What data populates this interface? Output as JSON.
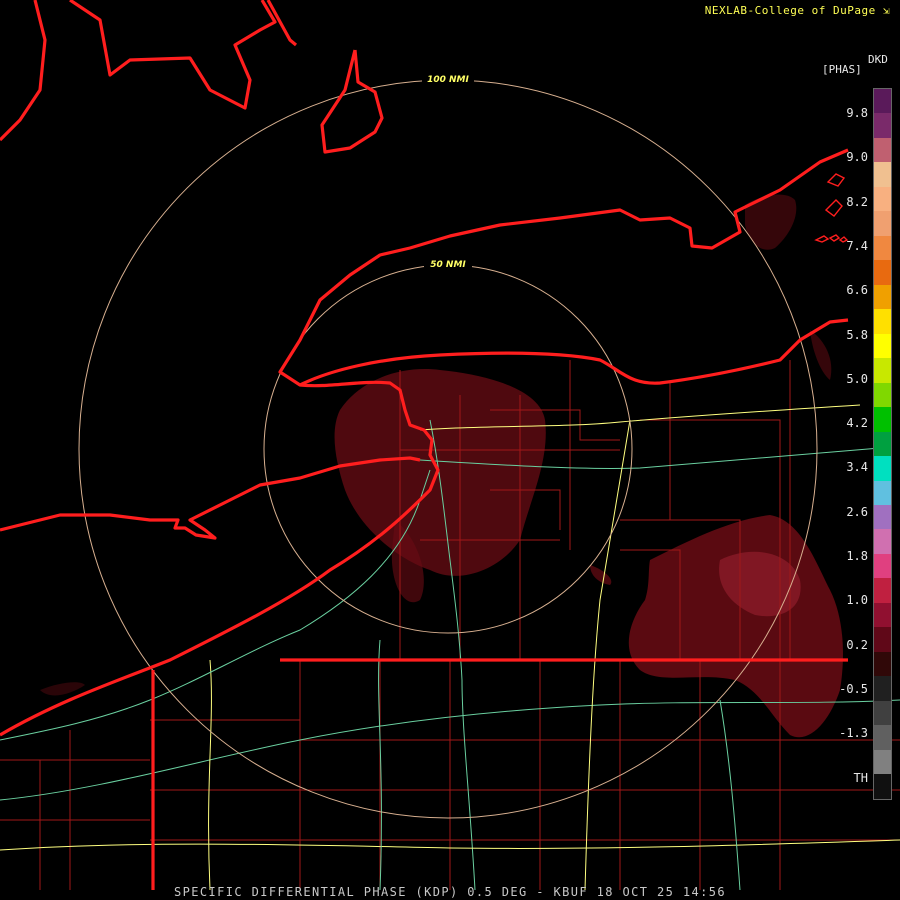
{
  "credit": "NEXLAB-College of DuPage",
  "credit_icon": "arrow-icon",
  "legend": {
    "product": "DKD",
    "unit": "[PHAS]",
    "ticks": [
      "9.8",
      "9.0",
      "8.2",
      "7.4",
      "6.6",
      "5.8",
      "5.0",
      "4.2",
      "3.4",
      "2.6",
      "1.8",
      "1.0",
      "0.2",
      "-0.5",
      "-1.3",
      "TH"
    ],
    "colors": [
      "#5a1a5a",
      "#7a2a6a",
      "#c06070",
      "#f0c090",
      "#f8b080",
      "#f0a070",
      "#f08840",
      "#e86a10",
      "#f0a000",
      "#ffe000",
      "#ffff00",
      "#c8e800",
      "#80d800",
      "#00c000",
      "#00a040",
      "#00e0c0",
      "#60c0e0",
      "#a070c0",
      "#d070b0",
      "#e04080",
      "#c02040",
      "#901030",
      "#600818",
      "#300808",
      "#202020",
      "#404040",
      "#606060",
      "#808080",
      "#101010"
    ]
  },
  "range_rings": [
    "50 NMI",
    "100 NMI"
  ],
  "footer": "SPECIFIC DIFFERENTIAL PHASE (KDP) 0.5 DEG - KBUF 18 OCT 25 14:56"
}
